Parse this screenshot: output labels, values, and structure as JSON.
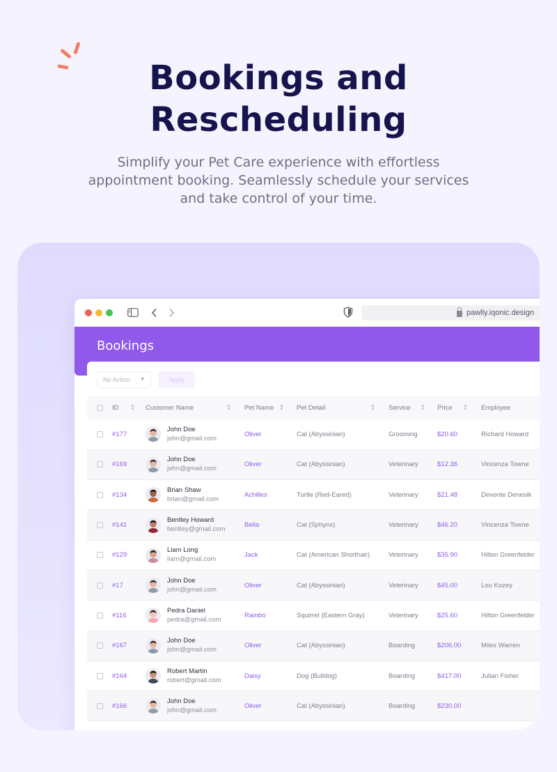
{
  "hero": {
    "title_line1": "Bookings and",
    "title_line2": "Rescheduling",
    "subtitle_line1": "Simplify your Pet Care experience with effortless",
    "subtitle_line2": "appointment booking. Seamlessly schedule your services",
    "subtitle_line3": "and take control of your time."
  },
  "browser": {
    "url": "pawlly.iqonic.design"
  },
  "page": {
    "title": "Bookings",
    "bulk_action_placeholder": "No Action",
    "apply_label": "Apply"
  },
  "table": {
    "headers": {
      "id": "ID",
      "customer": "Customer Name",
      "pet_name": "Pet Name",
      "pet_detail": "Pet Detail",
      "service": "Service",
      "price": "Price",
      "employee": "Employee"
    },
    "rows": [
      {
        "id": "#177",
        "name": "John Doe",
        "email": "john@gmail.com",
        "pet": "Oliver",
        "detail": "Cat (Abyssinian)",
        "service": "Grooming",
        "price": "$20.60",
        "employee": "Richard Howard"
      },
      {
        "id": "#169",
        "name": "John Doe",
        "email": "john@gmail.com",
        "pet": "Oliver",
        "detail": "Cat (Abyssinian)",
        "service": "Veterinary",
        "price": "$12.36",
        "employee": "Vincenza Towne"
      },
      {
        "id": "#134",
        "name": "Brian Shaw",
        "email": "brian@gmail.com",
        "pet": "Achilles",
        "detail": "Turtle (Red-Eared)",
        "service": "Veterinary",
        "price": "$21.48",
        "employee": "Devonte Denesik"
      },
      {
        "id": "#141",
        "name": "Bentley Howard",
        "email": "bentley@gmail.com",
        "pet": "Bella",
        "detail": "Cat (Sphynx)",
        "service": "Veterinary",
        "price": "$46.20",
        "employee": "Vincenza Towne"
      },
      {
        "id": "#129",
        "name": "Liam Long",
        "email": "liam@gmail.com",
        "pet": "Jack",
        "detail": "Cat (American Shorthair)",
        "service": "Veterinary",
        "price": "$35.90",
        "employee": "Hilton Greenfelder"
      },
      {
        "id": "#17",
        "name": "John Doe",
        "email": "john@gmail.com",
        "pet": "Oliver",
        "detail": "Cat (Abyssinian)",
        "service": "Veterinary",
        "price": "$45.00",
        "employee": "Lou Kozey"
      },
      {
        "id": "#116",
        "name": "Pedra Daniel",
        "email": "pedra@gmail.com",
        "pet": "Rambo",
        "detail": "Squirrel (Eastern Gray)",
        "service": "Veterinary",
        "price": "$25.60",
        "employee": "Hilton Greenfelder"
      },
      {
        "id": "#167",
        "name": "John Doe",
        "email": "john@gmail.com",
        "pet": "Oliver",
        "detail": "Cat (Abyssinian)",
        "service": "Boarding",
        "price": "$206.00",
        "employee": "Miles Warren"
      },
      {
        "id": "#164",
        "name": "Robert Martin",
        "email": "robert@gmail.com",
        "pet": "Daisy",
        "detail": "Dog (Bulldog)",
        "service": "Boarding",
        "price": "$417.00",
        "employee": "Julian Fisher"
      },
      {
        "id": "#166",
        "name": "John Doe",
        "email": "john@gmail.com",
        "pet": "Oliver",
        "detail": "Cat (Abyssinian)",
        "service": "Boarding",
        "price": "$230.00",
        "employee": ""
      }
    ]
  },
  "colors": {
    "accent": "#9159ea",
    "heading": "#17144d",
    "spark": "#f07f66"
  },
  "avatars": [
    "john",
    "john",
    "brian",
    "bentley",
    "liam",
    "john",
    "pedra",
    "john",
    "robert",
    "john"
  ]
}
